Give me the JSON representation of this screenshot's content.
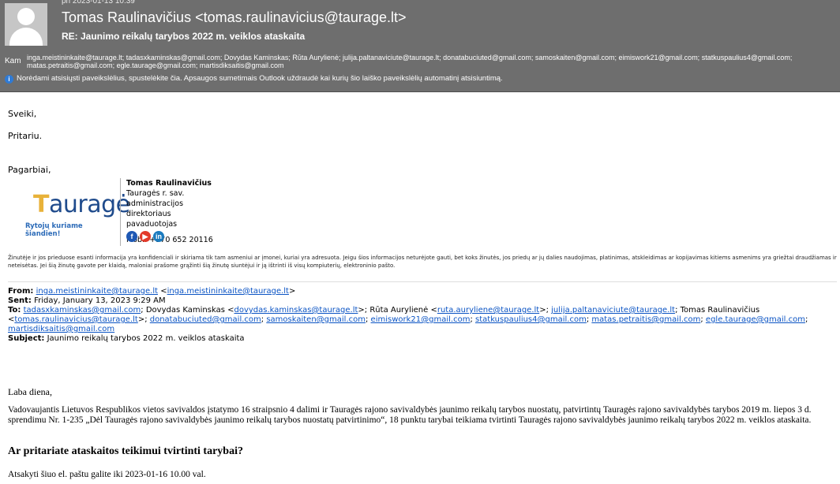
{
  "header": {
    "date": "pn 2023-01-13 10:39",
    "sender": "Tomas Raulinavičius <tomas.raulinavicius@taurage.lt>",
    "subject": "RE: Jaunimo reikalų tarybos 2022 m. veiklos ataskaita",
    "to_label": "Kam",
    "to_list_1": "inga.meistininkaite@taurage.lt; tadasxkaminskas@gmail.com; Dovydas Kaminskas; Rūta Aurylienė; julija.paltanaviciute@taurage.lt; donatabuciuted@gmail.com; samoskaiten@gmail.com; eimiswork21@gmail.com; statkuspaulius4@gmail.com;",
    "to_list_2": "matas.petraitis@gmail.com; egle.taurage@gmail.com; martisdiksaitis@gmail.com",
    "info_bar": "Norėdami atsisiųsti paveikslėlius, spustelėkite čia. Apsaugos sumetimais Outlook uždraudė kai kurių šio laiško paveikslėlių automatinį atsisiuntimą."
  },
  "body": {
    "greeting": "Sveiki,",
    "line": "Pritariu.",
    "closing": "Pagarbiai,"
  },
  "signature": {
    "logo_letter": "T",
    "logo_rest": "auragė",
    "logo_tagline": "Rytojų kuriame šiandien!",
    "name": "Tomas Raulinavičius",
    "position_1": "Tauragės r. sav. administracijos direktoriaus",
    "position_2": "pavaduotojas",
    "phone": "Mob.: +370 652 20116",
    "social_fb": "f",
    "social_yt": "▶",
    "social_in": "in"
  },
  "disclaimer": "Žinutėje ir jos prieduose esanti informacija yra konfidenciali ir skiriama tik tam asmeniui ar įmonei, kuriai yra adresuota. Jeigu šios informacijos neturėjote gauti, bet koks žinutės, jos priedų ar jų dalies naudojimas, platinimas, atskleidimas ar kopijavimas kitiems asmenims yra griežtai draudžiamas ir neteisėtas. Jei šią žinutę gavote per klaidą, maloniai prašome grąžinti šią žinutę siuntėjui ir ją ištrinti iš visų kompiuterių, elektroninio pašto.",
  "forwarded": {
    "from_label": "From:",
    "from_addr": "inga.meistininkaite@taurage.lt",
    "from_addr_bracket": "inga.meistininkaite@taurage.lt",
    "sent_label": "Sent:",
    "sent": "Friday, January 13, 2023 9:29 AM",
    "to_label": "To:",
    "to_1": "tadasxkaminskas@gmail.com",
    "to_2_name": "Dovydas Kaminskas",
    "to_2": "dovydas.kaminskas@taurage.lt",
    "to_3_name": "Rūta Aurylienė",
    "to_3": "ruta.auryliene@taurage.lt",
    "to_4": "julija.paltanaviciute@taurage.lt",
    "to_5_name": "Tomas Raulinavičius",
    "to_5": "tomas.raulinavicius@taurage.lt",
    "to_6": "donatabuciuted@gmail.com",
    "to_7": "samoskaiten@gmail.com",
    "to_8": "eimiswork21@gmail.com",
    "to_9": "statkuspaulius4@gmail.com",
    "to_10": "matas.petraitis@gmail.com",
    "to_11": "egle.taurage@gmail.com",
    "to_12": "martisdiksaitis@gmail.com",
    "subject_label": "Subject:",
    "subject": "Jaunimo reikalų tarybos 2022 m. veiklos ataskaita"
  },
  "original": {
    "greeting": "Laba diena,",
    "paragraph": "Vadovaujantis Lietuvos Respublikos vietos savivaldos įstatymo 16 straipsnio 4 dalimi ir Tauragės rajono savivaldybės jaunimo reikalų tarybos nuostatų, patvirtintų Tauragės rajono savivaldybės tarybos 2019 m. liepos 3 d. sprendimu Nr. 1-235 „Dėl Tauragės rajono savivaldybės jaunimo reikalų tarybos nuostatų patvirtinimo“, 18 punktu tarybai teikiama tvirtinti Tauragės rajono savivaldybės jaunimo reikalų tarybos 2022 m. veiklos ataskaita.",
    "question": "Ar pritariate ataskaitos teikimui tvirtinti tarybai?",
    "deadline": "Atsakyti šiuo el. paštu galite iki 2023-01-16 10.00 val."
  }
}
